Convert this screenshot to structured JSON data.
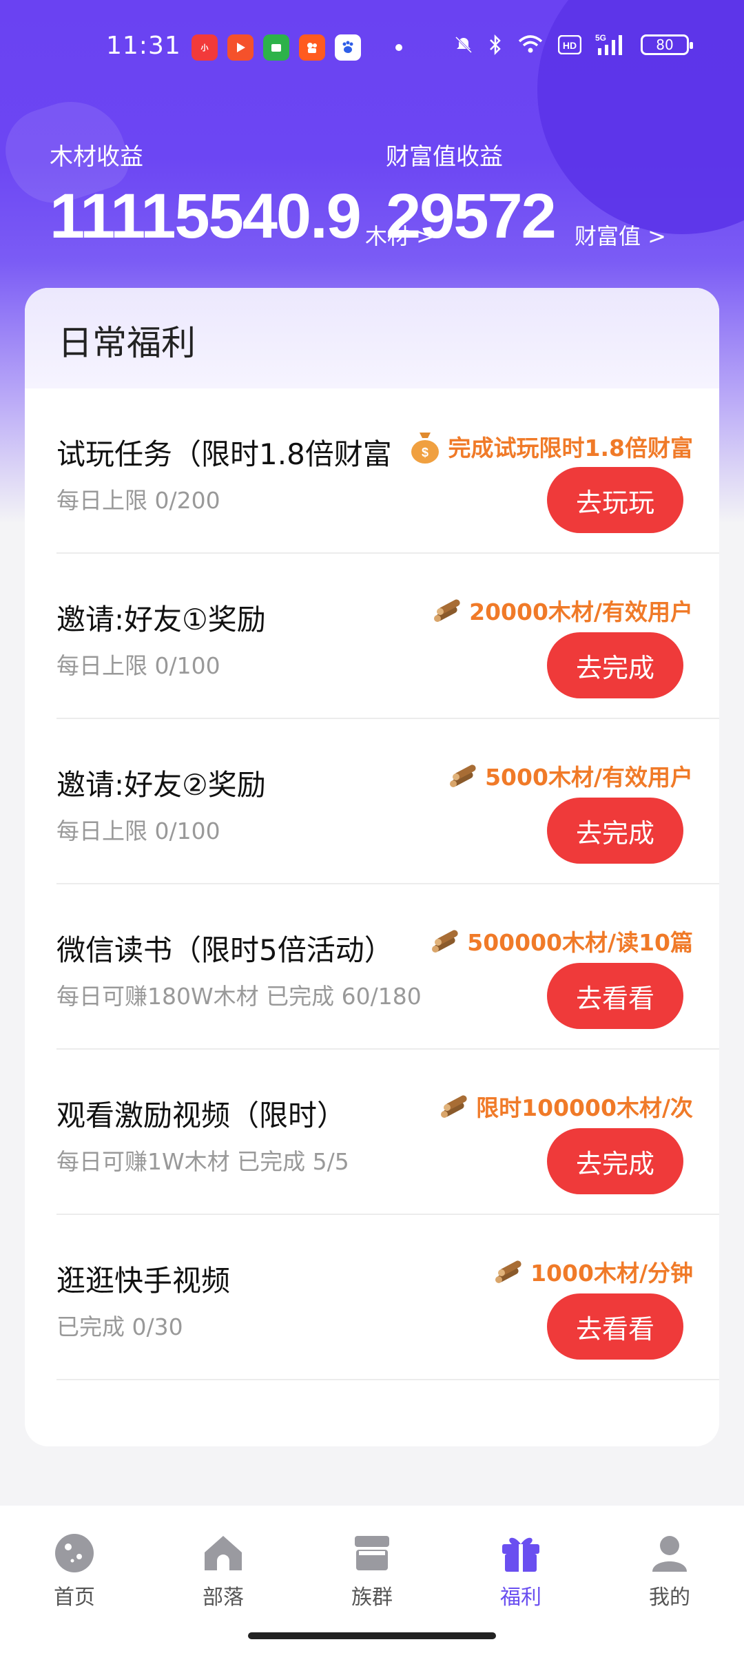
{
  "status_bar": {
    "time": "11:31",
    "app_icons": [
      "xiaohongshu-icon",
      "video-icon",
      "cart-icon",
      "kuaishou-icon",
      "baidu-icon"
    ],
    "network": "5G",
    "battery": "80"
  },
  "earnings": {
    "wood_label": "木材收益",
    "wood_value": "11115540.9",
    "wood_unit": "木材 >",
    "wealth_label": "财富值收益",
    "wealth_value": "29572",
    "wealth_unit": "财富值 >"
  },
  "card": {
    "title": "日常福利",
    "tasks": [
      {
        "title": "试玩任务（限时1.8倍财富",
        "sub": "每日上限 0/200",
        "reward": "完成试玩限时1.8倍财富",
        "reward_icon": "money-bag-icon",
        "button": "去玩玩"
      },
      {
        "title": "邀请:好友①奖励",
        "sub": "每日上限 0/100",
        "reward": "20000木材/有效用户",
        "reward_icon": "wood-icon",
        "button": "去完成"
      },
      {
        "title": "邀请:好友②奖励",
        "sub": "每日上限 0/100",
        "reward": "5000木材/有效用户",
        "reward_icon": "wood-icon",
        "button": "去完成"
      },
      {
        "title": "微信读书（限时5倍活动）",
        "sub": "每日可赚180W木材  已完成 60/180",
        "reward": "500000木材/读10篇",
        "reward_icon": "wood-icon",
        "button": "去看看"
      },
      {
        "title": "观看激励视频（限时）",
        "sub": "每日可赚1W木材 已完成 5/5",
        "reward": "限时100000木材/次",
        "reward_icon": "wood-icon",
        "button": "去完成"
      },
      {
        "title": "逛逛快手视频",
        "sub": "已完成 0/30",
        "reward": "1000木材/分钟",
        "reward_icon": "wood-icon",
        "button": "去看看"
      }
    ]
  },
  "nav": {
    "items": [
      {
        "label": "首页",
        "icon": "planet-icon"
      },
      {
        "label": "部落",
        "icon": "house-icon"
      },
      {
        "label": "族群",
        "icon": "store-icon"
      },
      {
        "label": "福利",
        "icon": "gift-icon",
        "active": true
      },
      {
        "label": "我的",
        "icon": "user-icon"
      }
    ]
  },
  "colors": {
    "brand": "#6a42f2",
    "button": "#ef3a3a",
    "reward": "#f07a28",
    "active_nav": "#6a4ff0"
  }
}
